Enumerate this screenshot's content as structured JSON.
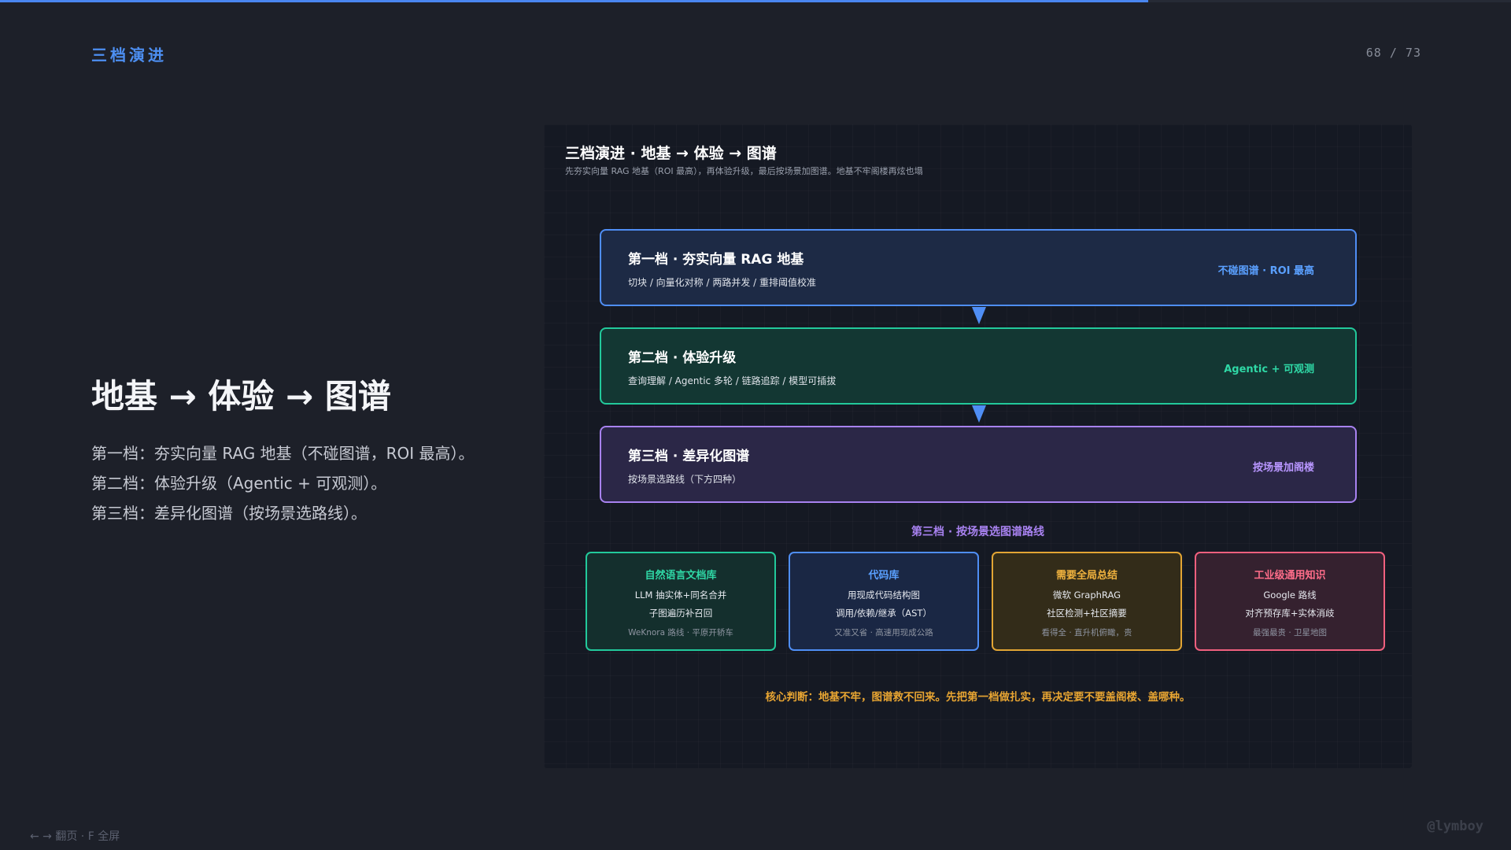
{
  "progress": {
    "fraction": 0.76,
    "color": "#4a86f0"
  },
  "header": {
    "section_label": "三档演进",
    "page_counter": "68 / 73"
  },
  "left": {
    "heading": "地基 → 体验 → 图谱",
    "lines": [
      "第一档：夯实向量 RAG 地基（不碰图谱，ROI 最高）。",
      "第二档：体验升级（Agentic + 可观测）。",
      "第三档：差异化图谱（按场景选路线）。"
    ]
  },
  "figure": {
    "title": "三档演进 · 地基 → 体验 → 图谱",
    "subtitle": "先夯实向量 RAG 地基（ROI 最高），再体验升级，最后按场景加图谱。地基不牢阁楼再炫也塌",
    "tiers": [
      {
        "name": "第一档 · 夯实向量 RAG 地基",
        "desc": "切块 / 向量化对称 / 两路并发 / 重排阈值校准",
        "tag": "不碰图谱 · ROI 最高",
        "color": "#4f8ef5"
      },
      {
        "name": "第二档 · 体验升级",
        "desc": "查询理解 / Agentic 多轮 / 链路追踪 / 模型可插拔",
        "tag": "Agentic + 可观测",
        "color": "#22c99b"
      },
      {
        "name": "第三档 · 差异化图谱",
        "desc": "按场景选路线（下方四种）",
        "tag": "按场景加阁楼",
        "color": "#a882f0"
      }
    ],
    "routes_heading": "第三档 · 按场景选图谱路线",
    "routes": [
      {
        "name": "自然语言文档库",
        "line1": "LLM 抽实体+同名合并",
        "line2": "子图遍历补召回",
        "note": "WeKnora 路线 · 平原开轿车",
        "color": "#22c99b"
      },
      {
        "name": "代码库",
        "line1": "用现成代码结构图",
        "line2": "调用/依赖/继承（AST）",
        "note": "又准又省 · 高速用现成公路",
        "color": "#4f8ef5"
      },
      {
        "name": "需要全局总结",
        "line1": "微软 GraphRAG",
        "line2": "社区检测+社区摘要",
        "note": "看得全 · 直升机俯瞰，贵",
        "color": "#e2a534"
      },
      {
        "name": "工业级通用知识",
        "line1": "Google 路线",
        "line2": "对齐预存库+实体消歧",
        "note": "最强最贵 · 卫星地图",
        "color": "#f0607e"
      }
    ],
    "verdict": "核心判断：地基不牢，图谱救不回来。先把第一档做扎实，再决定要不要盖阁楼、盖哪种。"
  },
  "footer": {
    "nav_hint": "← → 翻页 · F 全屏",
    "watermark": "@lymboy"
  }
}
